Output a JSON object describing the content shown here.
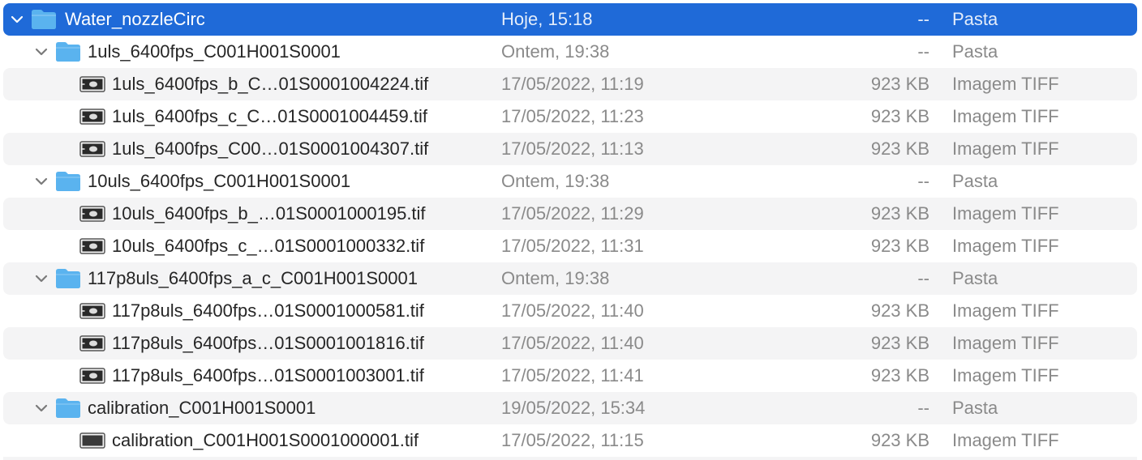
{
  "rows": [
    {
      "kind_type": "folder",
      "level": 0,
      "name": "Water_nozzleCirc",
      "date": "Hoje, 15:18",
      "size": "--",
      "kind": "Pasta",
      "selected": true,
      "expanded": true
    },
    {
      "kind_type": "folder",
      "level": 1,
      "name": "1uls_6400fps_C001H001S0001",
      "date": "Ontem, 19:38",
      "size": "--",
      "kind": "Pasta",
      "expanded": true
    },
    {
      "kind_type": "file",
      "level": 2,
      "name": "1uls_6400fps_b_C…01S0001004224.tif",
      "date": "17/05/2022, 11:19",
      "size": "923 KB",
      "kind": "Imagem TIFF"
    },
    {
      "kind_type": "file",
      "level": 2,
      "name": "1uls_6400fps_c_C…01S0001004459.tif",
      "date": "17/05/2022, 11:23",
      "size": "923 KB",
      "kind": "Imagem TIFF"
    },
    {
      "kind_type": "file",
      "level": 2,
      "name": "1uls_6400fps_C00…01S0001004307.tif",
      "date": "17/05/2022, 11:13",
      "size": "923 KB",
      "kind": "Imagem TIFF"
    },
    {
      "kind_type": "folder",
      "level": 1,
      "name": "10uls_6400fps_C001H001S0001",
      "date": "Ontem, 19:38",
      "size": "--",
      "kind": "Pasta",
      "expanded": true
    },
    {
      "kind_type": "file",
      "level": 2,
      "name": "10uls_6400fps_b_…01S0001000195.tif",
      "date": "17/05/2022, 11:29",
      "size": "923 KB",
      "kind": "Imagem TIFF"
    },
    {
      "kind_type": "file",
      "level": 2,
      "name": "10uls_6400fps_c_…01S0001000332.tif",
      "date": "17/05/2022, 11:31",
      "size": "923 KB",
      "kind": "Imagem TIFF"
    },
    {
      "kind_type": "folder",
      "level": 1,
      "name": "117p8uls_6400fps_a_c_C001H001S0001",
      "date": "Ontem, 19:38",
      "size": "--",
      "kind": "Pasta",
      "expanded": true
    },
    {
      "kind_type": "file",
      "level": 2,
      "name": "117p8uls_6400fps…01S0001000581.tif",
      "date": "17/05/2022, 11:40",
      "size": "923 KB",
      "kind": "Imagem TIFF"
    },
    {
      "kind_type": "file",
      "level": 2,
      "name": "117p8uls_6400fps…01S0001001816.tif",
      "date": "17/05/2022, 11:40",
      "size": "923 KB",
      "kind": "Imagem TIFF"
    },
    {
      "kind_type": "file",
      "level": 2,
      "name": "117p8uls_6400fps…01S0001003001.tif",
      "date": "17/05/2022, 11:41",
      "size": "923 KB",
      "kind": "Imagem TIFF"
    },
    {
      "kind_type": "folder",
      "level": 1,
      "name": "calibration_C001H001S0001",
      "date": "19/05/2022, 15:34",
      "size": "--",
      "kind": "Pasta",
      "expanded": true
    },
    {
      "kind_type": "file",
      "level": 2,
      "name": "calibration_C001H001S0001000001.tif",
      "date": "17/05/2022, 11:15",
      "size": "923 KB",
      "kind": "Imagem TIFF",
      "icon_variant": "plain"
    }
  ],
  "colors": {
    "selection": "#1f6ad8",
    "folder": "#5ab3ef",
    "alternate_row": "#f4f4f5",
    "secondary_text": "#8a8a8a"
  },
  "icons": {
    "folder": "folder-icon",
    "file": "tiff-image-icon",
    "disclosure": "chevron-down-icon"
  }
}
